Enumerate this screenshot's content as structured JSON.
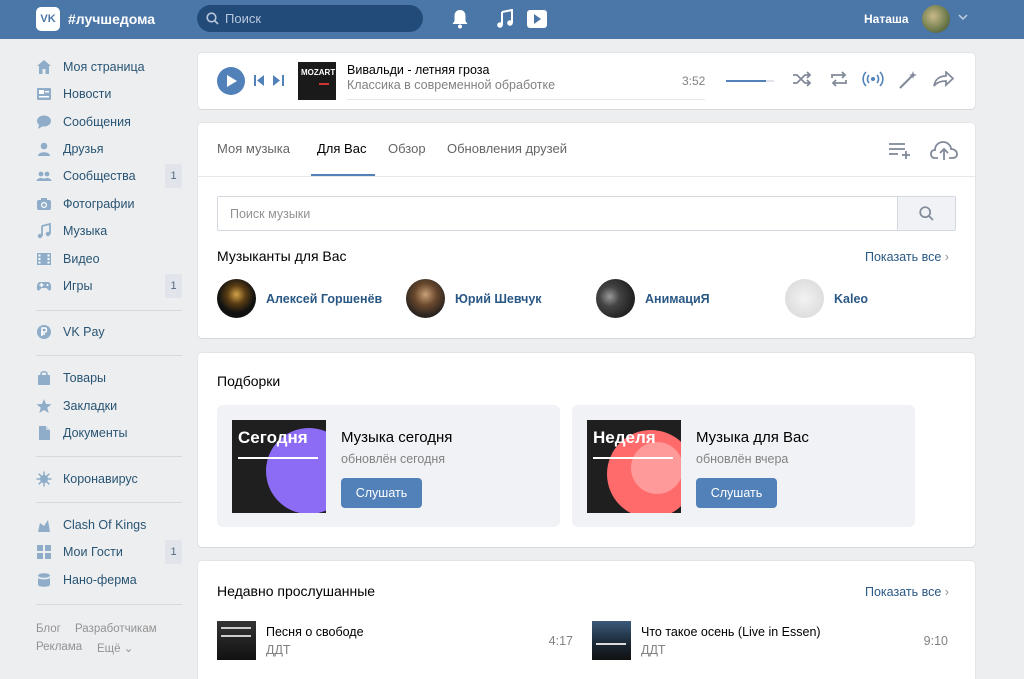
{
  "header": {
    "logo_text": "VK",
    "community": "#лучшедома",
    "search_placeholder": "Поиск",
    "user_name": "Наташа"
  },
  "nav": {
    "items": [
      {
        "label": "Моя страница",
        "icon": "home-icon"
      },
      {
        "label": "Новости",
        "icon": "news-icon"
      },
      {
        "label": "Сообщения",
        "icon": "messages-icon"
      },
      {
        "label": "Друзья",
        "icon": "friends-icon"
      },
      {
        "label": "Сообщества",
        "icon": "groups-icon",
        "badge": "1"
      },
      {
        "label": "Фотографии",
        "icon": "camera-icon"
      },
      {
        "label": "Музыка",
        "icon": "music-icon"
      },
      {
        "label": "Видео",
        "icon": "video-icon"
      },
      {
        "label": "Игры",
        "icon": "games-icon",
        "badge": "1"
      },
      {
        "label": "VK Pay",
        "icon": "vkpay-icon"
      },
      {
        "label": "Товары",
        "icon": "bag-icon"
      },
      {
        "label": "Закладки",
        "icon": "star-icon"
      },
      {
        "label": "Документы",
        "icon": "document-icon"
      },
      {
        "label": "Коронавирус",
        "icon": "virus-icon"
      },
      {
        "label": "Clash Of Kings",
        "icon": "game-app-icon"
      },
      {
        "label": "Мои Гости",
        "icon": "guests-icon",
        "badge": "1"
      },
      {
        "label": "Нано-ферма",
        "icon": "farm-icon"
      }
    ],
    "footer": [
      "Блог",
      "Разработчикам",
      "Реклама",
      "Ещё"
    ]
  },
  "player": {
    "cover_text": "MOZART",
    "title": "Вивальди - летняя гроза",
    "subtitle": "Классика в современной обработке",
    "time": "3:52",
    "volume": 0.83
  },
  "tabs": [
    "Моя музыка",
    "Для Вас",
    "Обзор",
    "Обновления друзей"
  ],
  "active_tab": "Для Вас",
  "music_search_placeholder": "Поиск музыки",
  "artists_section": {
    "title": "Музыканты для Вас",
    "show_all": "Показать все",
    "artists": [
      "Алексей Горшенёв",
      "Юрий Шевчук",
      "АнимациЯ",
      "Kaleo"
    ]
  },
  "collections": {
    "title": "Подборки",
    "items": [
      {
        "art_label": "Сегодня",
        "title": "Музыка сегодня",
        "subtitle": "обновлён сегодня",
        "button": "Слушать",
        "color": "#8d6cf5"
      },
      {
        "art_label": "Неделя",
        "title": "Музыка для Вас",
        "subtitle": "обновлён вчера",
        "button": "Слушать",
        "color": "#ff6b6b"
      }
    ]
  },
  "recent": {
    "title": "Недавно прослушанные",
    "show_all": "Показать все",
    "tracks": [
      {
        "title": "Песня о свободе",
        "artist": "ДДТ",
        "duration": "4:17"
      },
      {
        "title": "Что такое осень (Live in Essen)",
        "artist": "ДДТ",
        "duration": "9:10"
      }
    ]
  },
  "colors": {
    "header": "#4a76a8",
    "accent": "#5181b8",
    "link": "#2a5885"
  }
}
